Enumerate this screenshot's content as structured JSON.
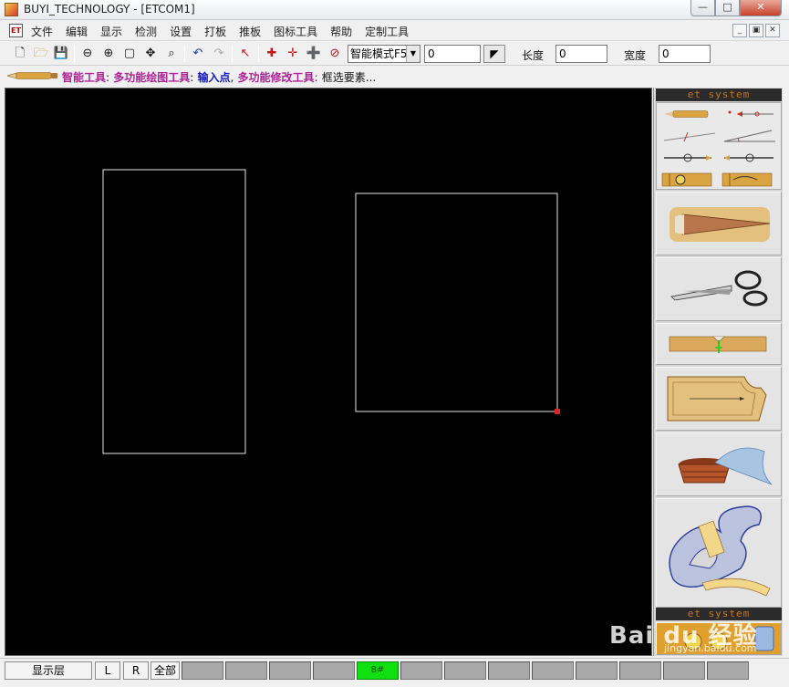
{
  "window": {
    "title": "BUYI_TECHNOLOGY - [ETCOM1]",
    "minimize": "0",
    "maximize": "1",
    "close": "r"
  },
  "menubar": {
    "doc_icon": "ET",
    "items": [
      "文件",
      "编辑",
      "显示",
      "检测",
      "设置",
      "打板",
      "推板",
      "图标工具",
      "帮助",
      "定制工具"
    ],
    "mdi_buttons": [
      "_",
      "▫",
      "x"
    ]
  },
  "toolbar": {
    "icons": [
      "new-file-icon",
      "open-folder-icon",
      "save-icon",
      "zoom-out-icon",
      "zoom-in-icon",
      "fit-window-icon",
      "pan-icon",
      "zoom-region-icon",
      "undo-icon",
      "redo-icon",
      "delete-select-icon",
      "snap-point-icon",
      "snap-cross-icon",
      "snap-plus-icon",
      "snap-remove-icon"
    ],
    "mode_value": "智能模式F5",
    "value_field": "0",
    "length_label": "长度",
    "length_value": "0",
    "width_label": "宽度",
    "width_value": "0"
  },
  "status": {
    "tool_label": "智能工具",
    "colon1": ":",
    "tool_name": "多功能绘图工具",
    "colon2": ":",
    "action": "输入点",
    "comma": ",",
    "modify_tool": "多功能修改工具",
    "colon3": ":",
    "modify_action": "框选要素..."
  },
  "canvas": {
    "background": "#000000",
    "shape_stroke": "#e6e6e6",
    "selected_point_color": "#dd2222"
  },
  "panel": {
    "header_top": "et system",
    "header_bottom": "et system",
    "small_tools": [
      "pencil-tool-icon",
      "point-arrow-tool-icon",
      "line-tool-icon",
      "angle-tool-icon",
      "compass-tool-icon",
      "compass-arc-tool-icon",
      "tape-measure-icon",
      "tape-curve-icon"
    ],
    "big_tools": [
      "pencil-draw-icon",
      "scissors-icon",
      "notch-tool-icon",
      "pattern-piece-icon",
      "sewing-basket-icon",
      "french-curve-icon"
    ]
  },
  "bottombar": {
    "layer_label": "显示层",
    "l_label": "L",
    "r_label": "R",
    "all_label": "全部",
    "active_slot_label": "8#"
  },
  "watermark": {
    "logo": "Bai du 经验",
    "url": "jingyan.baidu.com"
  }
}
